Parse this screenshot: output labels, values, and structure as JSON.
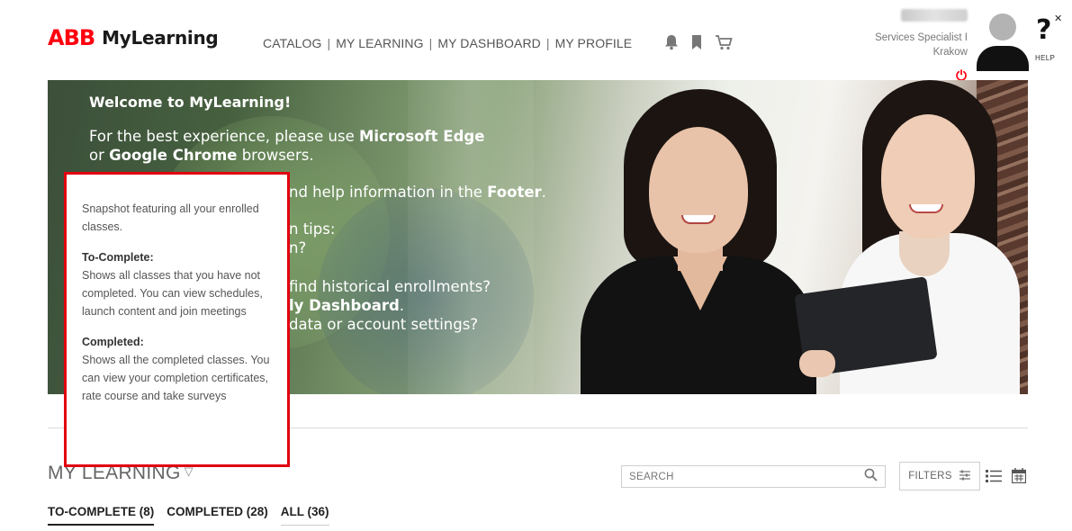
{
  "header": {
    "logo_text": "ABB",
    "brand": "MyLearning",
    "nav": [
      "CATALOG",
      "MY LEARNING",
      "MY DASHBOARD",
      "MY PROFILE"
    ],
    "user_role": "Services Specialist I",
    "user_location": "Krakow",
    "help_label": "HELP",
    "icons": [
      "bell-icon",
      "bookmark-icon",
      "cart-icon",
      "power-icon",
      "help-icon",
      "close-icon"
    ]
  },
  "hero": {
    "welcome": "Welcome to MyLearning!",
    "line1_a": "For the best experience, please use ",
    "line1_b": "Microsoft Edge",
    "line2_a": "or ",
    "line2_b": "Google Chrome",
    "line2_c": " browsers.",
    "line3_a": "nd help information in the ",
    "line3_b": "Footer",
    "line3_c": ".",
    "line4": "n tips:",
    "line5": "n?",
    "line6": "find historical enrollments?",
    "line7_a": "ly Dashboard",
    "line7_b": ".",
    "line8": "data or account settings?"
  },
  "tooltip": {
    "intro": "Snapshot featuring all your enrolled classes.",
    "to_complete_title": "To-Complete:",
    "to_complete_body": "Shows all classes that you have not completed. You can view schedules, launch content and join meetings",
    "completed_title": "Completed:",
    "completed_body": "Shows all the completed classes. You can view your completion certificates, rate course and take surveys"
  },
  "main": {
    "section_title": "MY LEARNING",
    "search_placeholder": "SEARCH",
    "filters_label": "FILTERS",
    "tabs": [
      {
        "label": "TO-COMPLETE (8)",
        "active": true
      },
      {
        "label": "COMPLETED (28)",
        "active": false
      },
      {
        "label": "ALL (36)",
        "active": false
      }
    ]
  },
  "colors": {
    "brand_red": "#ff000f",
    "tooltip_border": "#e1000f"
  }
}
